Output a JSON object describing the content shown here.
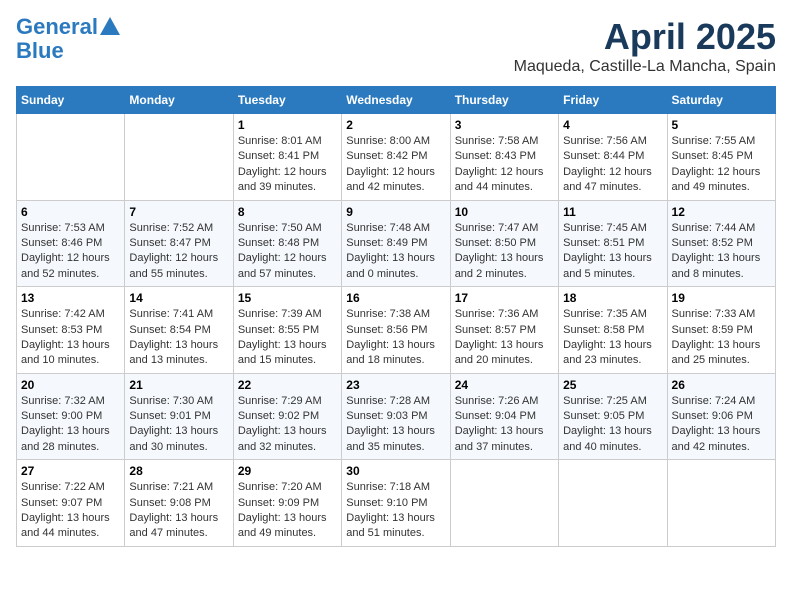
{
  "header": {
    "logo_general": "General",
    "logo_blue": "Blue",
    "month": "April 2025",
    "location": "Maqueda, Castille-La Mancha, Spain"
  },
  "days_of_week": [
    "Sunday",
    "Monday",
    "Tuesday",
    "Wednesday",
    "Thursday",
    "Friday",
    "Saturday"
  ],
  "weeks": [
    [
      {
        "day": "",
        "info": ""
      },
      {
        "day": "",
        "info": ""
      },
      {
        "day": "1",
        "info": "Sunrise: 8:01 AM\nSunset: 8:41 PM\nDaylight: 12 hours and 39 minutes."
      },
      {
        "day": "2",
        "info": "Sunrise: 8:00 AM\nSunset: 8:42 PM\nDaylight: 12 hours and 42 minutes."
      },
      {
        "day": "3",
        "info": "Sunrise: 7:58 AM\nSunset: 8:43 PM\nDaylight: 12 hours and 44 minutes."
      },
      {
        "day": "4",
        "info": "Sunrise: 7:56 AM\nSunset: 8:44 PM\nDaylight: 12 hours and 47 minutes."
      },
      {
        "day": "5",
        "info": "Sunrise: 7:55 AM\nSunset: 8:45 PM\nDaylight: 12 hours and 49 minutes."
      }
    ],
    [
      {
        "day": "6",
        "info": "Sunrise: 7:53 AM\nSunset: 8:46 PM\nDaylight: 12 hours and 52 minutes."
      },
      {
        "day": "7",
        "info": "Sunrise: 7:52 AM\nSunset: 8:47 PM\nDaylight: 12 hours and 55 minutes."
      },
      {
        "day": "8",
        "info": "Sunrise: 7:50 AM\nSunset: 8:48 PM\nDaylight: 12 hours and 57 minutes."
      },
      {
        "day": "9",
        "info": "Sunrise: 7:48 AM\nSunset: 8:49 PM\nDaylight: 13 hours and 0 minutes."
      },
      {
        "day": "10",
        "info": "Sunrise: 7:47 AM\nSunset: 8:50 PM\nDaylight: 13 hours and 2 minutes."
      },
      {
        "day": "11",
        "info": "Sunrise: 7:45 AM\nSunset: 8:51 PM\nDaylight: 13 hours and 5 minutes."
      },
      {
        "day": "12",
        "info": "Sunrise: 7:44 AM\nSunset: 8:52 PM\nDaylight: 13 hours and 8 minutes."
      }
    ],
    [
      {
        "day": "13",
        "info": "Sunrise: 7:42 AM\nSunset: 8:53 PM\nDaylight: 13 hours and 10 minutes."
      },
      {
        "day": "14",
        "info": "Sunrise: 7:41 AM\nSunset: 8:54 PM\nDaylight: 13 hours and 13 minutes."
      },
      {
        "day": "15",
        "info": "Sunrise: 7:39 AM\nSunset: 8:55 PM\nDaylight: 13 hours and 15 minutes."
      },
      {
        "day": "16",
        "info": "Sunrise: 7:38 AM\nSunset: 8:56 PM\nDaylight: 13 hours and 18 minutes."
      },
      {
        "day": "17",
        "info": "Sunrise: 7:36 AM\nSunset: 8:57 PM\nDaylight: 13 hours and 20 minutes."
      },
      {
        "day": "18",
        "info": "Sunrise: 7:35 AM\nSunset: 8:58 PM\nDaylight: 13 hours and 23 minutes."
      },
      {
        "day": "19",
        "info": "Sunrise: 7:33 AM\nSunset: 8:59 PM\nDaylight: 13 hours and 25 minutes."
      }
    ],
    [
      {
        "day": "20",
        "info": "Sunrise: 7:32 AM\nSunset: 9:00 PM\nDaylight: 13 hours and 28 minutes."
      },
      {
        "day": "21",
        "info": "Sunrise: 7:30 AM\nSunset: 9:01 PM\nDaylight: 13 hours and 30 minutes."
      },
      {
        "day": "22",
        "info": "Sunrise: 7:29 AM\nSunset: 9:02 PM\nDaylight: 13 hours and 32 minutes."
      },
      {
        "day": "23",
        "info": "Sunrise: 7:28 AM\nSunset: 9:03 PM\nDaylight: 13 hours and 35 minutes."
      },
      {
        "day": "24",
        "info": "Sunrise: 7:26 AM\nSunset: 9:04 PM\nDaylight: 13 hours and 37 minutes."
      },
      {
        "day": "25",
        "info": "Sunrise: 7:25 AM\nSunset: 9:05 PM\nDaylight: 13 hours and 40 minutes."
      },
      {
        "day": "26",
        "info": "Sunrise: 7:24 AM\nSunset: 9:06 PM\nDaylight: 13 hours and 42 minutes."
      }
    ],
    [
      {
        "day": "27",
        "info": "Sunrise: 7:22 AM\nSunset: 9:07 PM\nDaylight: 13 hours and 44 minutes."
      },
      {
        "day": "28",
        "info": "Sunrise: 7:21 AM\nSunset: 9:08 PM\nDaylight: 13 hours and 47 minutes."
      },
      {
        "day": "29",
        "info": "Sunrise: 7:20 AM\nSunset: 9:09 PM\nDaylight: 13 hours and 49 minutes."
      },
      {
        "day": "30",
        "info": "Sunrise: 7:18 AM\nSunset: 9:10 PM\nDaylight: 13 hours and 51 minutes."
      },
      {
        "day": "",
        "info": ""
      },
      {
        "day": "",
        "info": ""
      },
      {
        "day": "",
        "info": ""
      }
    ]
  ]
}
